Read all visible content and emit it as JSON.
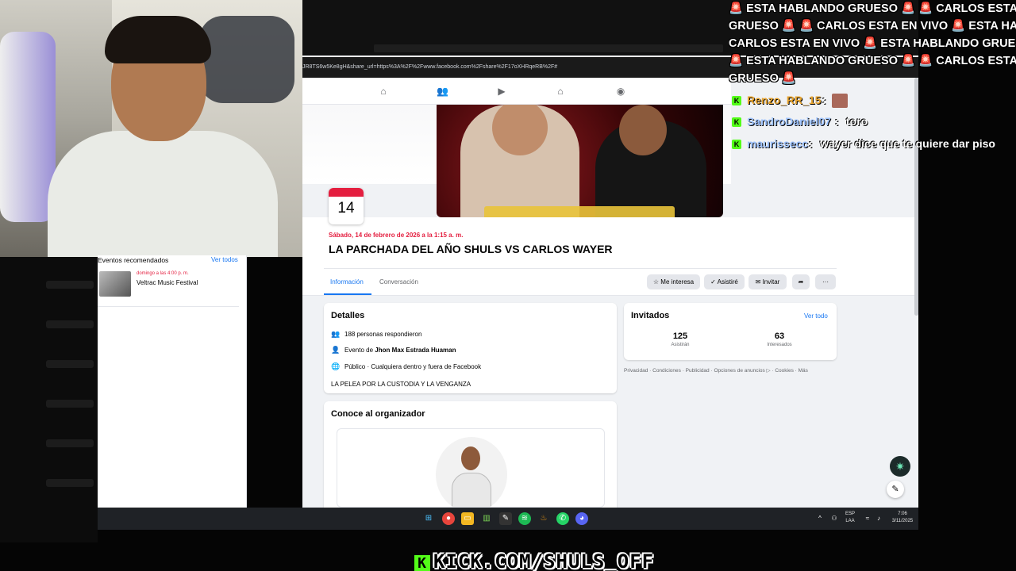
{
  "browser": {
    "address_text": "JR8TS6w5Ke8gH&share_url=https%3A%2F%2Fwww.facebook.com%2Fshare%2F17oXHRqeRB%2F#"
  },
  "event": {
    "day": "14",
    "date_text": "Sábado, 14 de febrero de 2026 a la 1:15 a. m.",
    "title": "LA PARCHADA DEL AÑO SHULS VS CARLOS WAYER"
  },
  "tabs": {
    "info": "Información",
    "conversation": "Conversación"
  },
  "actions": {
    "interested": "Me interesa",
    "going": "Asistiré",
    "invite": "Invitar"
  },
  "details": {
    "title": "Detalles",
    "responded": "188 personas respondieron",
    "event_by_prefix": "Evento de ",
    "event_by_name": "Jhon Max Estrada Huaman",
    "visibility": "Público · Cualquiera dentro y fuera de Facebook",
    "description": "LA PELEA POR LA CUSTODIA Y LA VENGANZA"
  },
  "guests": {
    "title": "Invitados",
    "see_all": "Ver todo",
    "going_count": "125",
    "going_label": "Asistirán",
    "interested_count": "63",
    "interested_label": "Interesados"
  },
  "footer": {
    "links": "Privacidad · Condiciones · Publicidad · Opciones de anuncios ▷ · Cookies · Más"
  },
  "organizer": {
    "title": "Conoce al organizador"
  },
  "recommended": {
    "title": "Eventos recomendados",
    "see_all": "Ver todos",
    "item_date": "domingo a las 4:00 p. m.",
    "item_name": "Veltrac Music Festival"
  },
  "taskbar": {
    "lang": "ESP",
    "lang2": "LAA",
    "time": "7:06",
    "date": "3/11/2025"
  },
  "ticker": {
    "line1": "🚨 ESTA HABLANDO GRUESO 🚨 🚨 CARLOS ESTA EN",
    "line2": "GRUESO 🚨 🚨 CARLOS ESTA EN VIVO 🚨 ESTA HABL",
    "line3": "CARLOS ESTA EN VIVO 🚨 ESTA HABLANDO GRUESO",
    "line4": "🚨 ESTA HABLANDO GRUESO 🚨 🚨 CARLOS ESTA EN",
    "line5": "GRUESO 🚨"
  },
  "chat": [
    {
      "user": "Renzo_RR_15",
      "sep": " :",
      "msg": "",
      "color": "#e8a531"
    },
    {
      "user": "SandroDaniel07",
      "sep": " :",
      "msg": "toro",
      "color": "#9ec3ff"
    },
    {
      "user": "maurissecc",
      "sep": " :",
      "msg": "wayer dice que te quiere dar piso",
      "color": "#9ec3ff"
    }
  ],
  "watermark": {
    "text": "KICK.COM/SHULS_OFF",
    "badge": "K"
  },
  "colors": {
    "fb_blue": "#1877f2",
    "fb_red": "#e41e3f",
    "kick_green": "#53fc18"
  }
}
